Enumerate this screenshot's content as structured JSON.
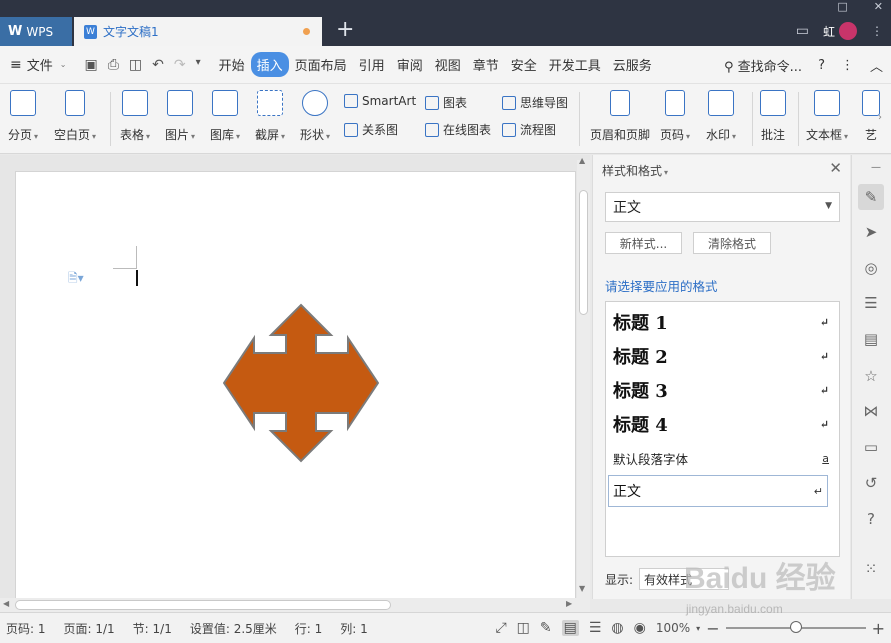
{
  "titlebar": {
    "app_tab": "WPS",
    "doc_tab": "文字文稿1",
    "new_tab": "+",
    "user_name": "虹"
  },
  "menubar": {
    "file_label": "文件",
    "menus": [
      "开始",
      "插入",
      "页面布局",
      "引用",
      "审阅",
      "视图",
      "章节",
      "安全",
      "开发工具",
      "云服务"
    ],
    "active_menu": "插入",
    "search_label": "查找命令...",
    "help": "?"
  },
  "ribbon": {
    "page_break": "分页",
    "blank_page": "空白页",
    "table": "表格",
    "picture": "图片",
    "gallery": "图库",
    "screenshot": "截屏",
    "shapes": "形状",
    "smartart": "SmartArt",
    "relation": "关系图",
    "chart": "图表",
    "online_chart": "在线图表",
    "mindmap": "思维导图",
    "flowchart": "流程图",
    "header_footer": "页眉和页脚",
    "page_number": "页码",
    "watermark": "水印",
    "comment": "批注",
    "textbox": "文本框",
    "art": "艺"
  },
  "panel": {
    "title": "样式和格式",
    "current_style": "正文",
    "new_style": "新样式...",
    "clear_format": "清除格式",
    "apply_label": "请选择要应用的格式",
    "styles": [
      "标题 1",
      "标题 2",
      "标题 3",
      "标题 4"
    ],
    "default_font": "默认段落字体",
    "default_font_mark": "a",
    "body_style": "正文",
    "para_mark": "↵",
    "show_label": "显示:",
    "show_value": "有效样式"
  },
  "statusbar": {
    "page_num": "页码: 1",
    "pages": "页面: 1/1",
    "section": "节: 1/1",
    "setting": "设置值: 2.5厘米",
    "row": "行: 1",
    "col": "列: 1",
    "zoom": "100%",
    "zoom_level": 0.5
  },
  "colors": {
    "shape_fill": "#c55a11",
    "shape_stroke": "#7b7b7b",
    "accent": "#4a8fe3"
  },
  "watermark_text": "Baidu 经验",
  "watermark_url": "jingyan.baidu.com"
}
